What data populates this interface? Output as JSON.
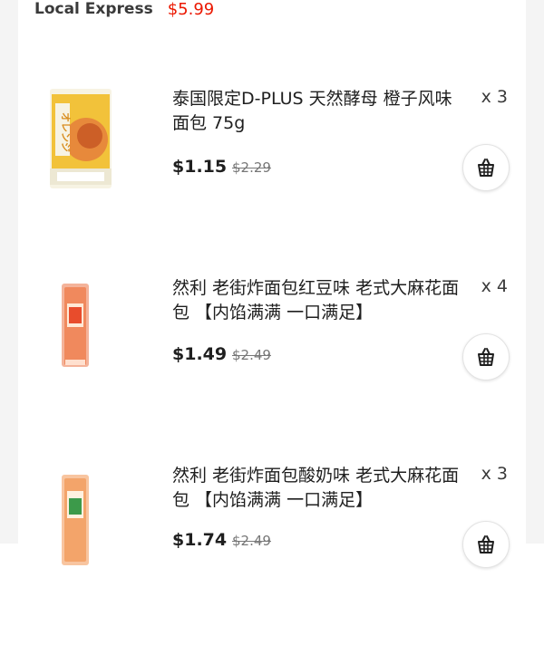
{
  "header": {
    "store_name": "Local Express",
    "total": "$5.99"
  },
  "items": [
    {
      "title": "泰国限定D-PLUS 天然酵母 橙子风味面包 75g",
      "quantity": "x 3",
      "price": "$1.15",
      "original_price": "$2.29",
      "thumb_text": "オレンジ"
    },
    {
      "title": "然利 老街炸面包红豆味 老式大麻花面包 【内馅满满 一口满足】",
      "quantity": "x 4",
      "price": "$1.49",
      "original_price": "$2.49"
    },
    {
      "title": "然利 老街炸面包酸奶味 老式大麻花面包 【内馅满满 一口满足】",
      "quantity": "x 3",
      "price": "$1.74",
      "original_price": "$2.49"
    }
  ],
  "colors": {
    "accent_red": "#eb1700"
  }
}
